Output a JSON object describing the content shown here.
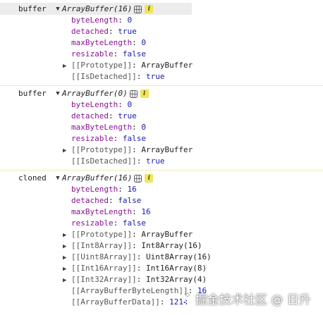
{
  "colors": {
    "header_highlight": "#ececec",
    "separator": "#f0e9b8",
    "property_key": "#881391",
    "internal_key": "#565656",
    "number_value": "#1a1aa6",
    "info_badge": "#f0e45a"
  },
  "icons": {
    "expanded": "triangle-down",
    "collapsed": "triangle-right",
    "table_view": "grid-icon",
    "info": "info-icon"
  },
  "entries": [
    {
      "label": "buffer",
      "object": "ArrayBuffer(16)",
      "info": "i",
      "props": [
        {
          "key": "byteLength",
          "colon": ": ",
          "value": "0"
        },
        {
          "key": "detached",
          "colon": ": ",
          "value": "true"
        },
        {
          "key": "maxByteLength",
          "colon": ": ",
          "value": "0"
        },
        {
          "key": "resizable",
          "colon": ": ",
          "value": "false"
        }
      ],
      "internals": [
        {
          "key": "[[Prototype]]",
          "colon": ": ",
          "value": "ArrayBuffer",
          "expandable": true
        },
        {
          "key": "[[IsDetached]]",
          "colon": ": ",
          "value": "true",
          "expandable": false
        }
      ]
    },
    {
      "label": "buffer",
      "object": "ArrayBuffer(0)",
      "info": "i",
      "props": [
        {
          "key": "byteLength",
          "colon": ": ",
          "value": "0"
        },
        {
          "key": "detached",
          "colon": ": ",
          "value": "true"
        },
        {
          "key": "maxByteLength",
          "colon": ": ",
          "value": "0"
        },
        {
          "key": "resizable",
          "colon": ": ",
          "value": "false"
        }
      ],
      "internals": [
        {
          "key": "[[Prototype]]",
          "colon": ": ",
          "value": "ArrayBuffer",
          "expandable": true
        },
        {
          "key": "[[IsDetached]]",
          "colon": ": ",
          "value": "true",
          "expandable": false
        }
      ]
    },
    {
      "label": "cloned",
      "object": "ArrayBuffer(16)",
      "info": "i",
      "props": [
        {
          "key": "byteLength",
          "colon": ": ",
          "value": "16"
        },
        {
          "key": "detached",
          "colon": ": ",
          "value": "false"
        },
        {
          "key": "maxByteLength",
          "colon": ": ",
          "value": "16"
        },
        {
          "key": "resizable",
          "colon": ": ",
          "value": "false"
        }
      ],
      "internals": [
        {
          "key": "[[Prototype]]",
          "colon": ": ",
          "value": "ArrayBuffer",
          "expandable": true
        },
        {
          "key": "[[Int8Array]]",
          "colon": ": ",
          "value": "Int8Array(16)",
          "expandable": true
        },
        {
          "key": "[[Uint8Array]]",
          "colon": ": ",
          "value": "Uint8Array(16)",
          "expandable": true
        },
        {
          "key": "[[Int16Array]]",
          "colon": ": ",
          "value": "Int16Array(8)",
          "expandable": true
        },
        {
          "key": "[[Int32Array]]",
          "colon": ": ",
          "value": "Int32Array(4)",
          "expandable": true
        },
        {
          "key": "[[ArrayBufferByteLength]]",
          "colon": ": ",
          "value": "16",
          "expandable": false
        },
        {
          "key": "[[ArrayBufferData]]",
          "colon": ": ",
          "value": "1214",
          "expandable": false
        }
      ]
    }
  ],
  "watermark": {
    "text": "掘金技术社区 @ 日升"
  }
}
